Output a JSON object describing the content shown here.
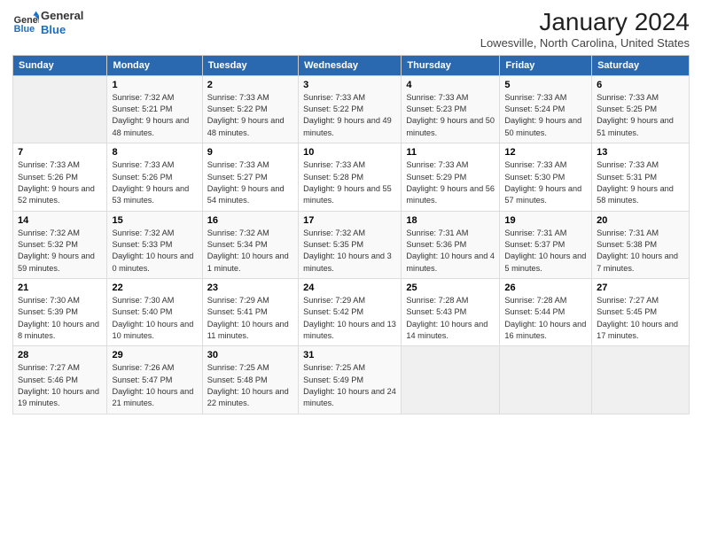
{
  "header": {
    "logo_line1": "General",
    "logo_line2": "Blue",
    "month_year": "January 2024",
    "location": "Lowesville, North Carolina, United States"
  },
  "columns": [
    "Sunday",
    "Monday",
    "Tuesday",
    "Wednesday",
    "Thursday",
    "Friday",
    "Saturday"
  ],
  "weeks": [
    [
      {
        "day": "",
        "empty": true
      },
      {
        "day": "1",
        "sunrise": "Sunrise: 7:32 AM",
        "sunset": "Sunset: 5:21 PM",
        "daylight": "Daylight: 9 hours and 48 minutes."
      },
      {
        "day": "2",
        "sunrise": "Sunrise: 7:33 AM",
        "sunset": "Sunset: 5:22 PM",
        "daylight": "Daylight: 9 hours and 48 minutes."
      },
      {
        "day": "3",
        "sunrise": "Sunrise: 7:33 AM",
        "sunset": "Sunset: 5:22 PM",
        "daylight": "Daylight: 9 hours and 49 minutes."
      },
      {
        "day": "4",
        "sunrise": "Sunrise: 7:33 AM",
        "sunset": "Sunset: 5:23 PM",
        "daylight": "Daylight: 9 hours and 50 minutes."
      },
      {
        "day": "5",
        "sunrise": "Sunrise: 7:33 AM",
        "sunset": "Sunset: 5:24 PM",
        "daylight": "Daylight: 9 hours and 50 minutes."
      },
      {
        "day": "6",
        "sunrise": "Sunrise: 7:33 AM",
        "sunset": "Sunset: 5:25 PM",
        "daylight": "Daylight: 9 hours and 51 minutes."
      }
    ],
    [
      {
        "day": "7",
        "sunrise": "Sunrise: 7:33 AM",
        "sunset": "Sunset: 5:26 PM",
        "daylight": "Daylight: 9 hours and 52 minutes."
      },
      {
        "day": "8",
        "sunrise": "Sunrise: 7:33 AM",
        "sunset": "Sunset: 5:26 PM",
        "daylight": "Daylight: 9 hours and 53 minutes."
      },
      {
        "day": "9",
        "sunrise": "Sunrise: 7:33 AM",
        "sunset": "Sunset: 5:27 PM",
        "daylight": "Daylight: 9 hours and 54 minutes."
      },
      {
        "day": "10",
        "sunrise": "Sunrise: 7:33 AM",
        "sunset": "Sunset: 5:28 PM",
        "daylight": "Daylight: 9 hours and 55 minutes."
      },
      {
        "day": "11",
        "sunrise": "Sunrise: 7:33 AM",
        "sunset": "Sunset: 5:29 PM",
        "daylight": "Daylight: 9 hours and 56 minutes."
      },
      {
        "day": "12",
        "sunrise": "Sunrise: 7:33 AM",
        "sunset": "Sunset: 5:30 PM",
        "daylight": "Daylight: 9 hours and 57 minutes."
      },
      {
        "day": "13",
        "sunrise": "Sunrise: 7:33 AM",
        "sunset": "Sunset: 5:31 PM",
        "daylight": "Daylight: 9 hours and 58 minutes."
      }
    ],
    [
      {
        "day": "14",
        "sunrise": "Sunrise: 7:32 AM",
        "sunset": "Sunset: 5:32 PM",
        "daylight": "Daylight: 9 hours and 59 minutes."
      },
      {
        "day": "15",
        "sunrise": "Sunrise: 7:32 AM",
        "sunset": "Sunset: 5:33 PM",
        "daylight": "Daylight: 10 hours and 0 minutes."
      },
      {
        "day": "16",
        "sunrise": "Sunrise: 7:32 AM",
        "sunset": "Sunset: 5:34 PM",
        "daylight": "Daylight: 10 hours and 1 minute."
      },
      {
        "day": "17",
        "sunrise": "Sunrise: 7:32 AM",
        "sunset": "Sunset: 5:35 PM",
        "daylight": "Daylight: 10 hours and 3 minutes."
      },
      {
        "day": "18",
        "sunrise": "Sunrise: 7:31 AM",
        "sunset": "Sunset: 5:36 PM",
        "daylight": "Daylight: 10 hours and 4 minutes."
      },
      {
        "day": "19",
        "sunrise": "Sunrise: 7:31 AM",
        "sunset": "Sunset: 5:37 PM",
        "daylight": "Daylight: 10 hours and 5 minutes."
      },
      {
        "day": "20",
        "sunrise": "Sunrise: 7:31 AM",
        "sunset": "Sunset: 5:38 PM",
        "daylight": "Daylight: 10 hours and 7 minutes."
      }
    ],
    [
      {
        "day": "21",
        "sunrise": "Sunrise: 7:30 AM",
        "sunset": "Sunset: 5:39 PM",
        "daylight": "Daylight: 10 hours and 8 minutes."
      },
      {
        "day": "22",
        "sunrise": "Sunrise: 7:30 AM",
        "sunset": "Sunset: 5:40 PM",
        "daylight": "Daylight: 10 hours and 10 minutes."
      },
      {
        "day": "23",
        "sunrise": "Sunrise: 7:29 AM",
        "sunset": "Sunset: 5:41 PM",
        "daylight": "Daylight: 10 hours and 11 minutes."
      },
      {
        "day": "24",
        "sunrise": "Sunrise: 7:29 AM",
        "sunset": "Sunset: 5:42 PM",
        "daylight": "Daylight: 10 hours and 13 minutes."
      },
      {
        "day": "25",
        "sunrise": "Sunrise: 7:28 AM",
        "sunset": "Sunset: 5:43 PM",
        "daylight": "Daylight: 10 hours and 14 minutes."
      },
      {
        "day": "26",
        "sunrise": "Sunrise: 7:28 AM",
        "sunset": "Sunset: 5:44 PM",
        "daylight": "Daylight: 10 hours and 16 minutes."
      },
      {
        "day": "27",
        "sunrise": "Sunrise: 7:27 AM",
        "sunset": "Sunset: 5:45 PM",
        "daylight": "Daylight: 10 hours and 17 minutes."
      }
    ],
    [
      {
        "day": "28",
        "sunrise": "Sunrise: 7:27 AM",
        "sunset": "Sunset: 5:46 PM",
        "daylight": "Daylight: 10 hours and 19 minutes."
      },
      {
        "day": "29",
        "sunrise": "Sunrise: 7:26 AM",
        "sunset": "Sunset: 5:47 PM",
        "daylight": "Daylight: 10 hours and 21 minutes."
      },
      {
        "day": "30",
        "sunrise": "Sunrise: 7:25 AM",
        "sunset": "Sunset: 5:48 PM",
        "daylight": "Daylight: 10 hours and 22 minutes."
      },
      {
        "day": "31",
        "sunrise": "Sunrise: 7:25 AM",
        "sunset": "Sunset: 5:49 PM",
        "daylight": "Daylight: 10 hours and 24 minutes."
      },
      {
        "day": "",
        "empty": true
      },
      {
        "day": "",
        "empty": true
      },
      {
        "day": "",
        "empty": true
      }
    ]
  ]
}
